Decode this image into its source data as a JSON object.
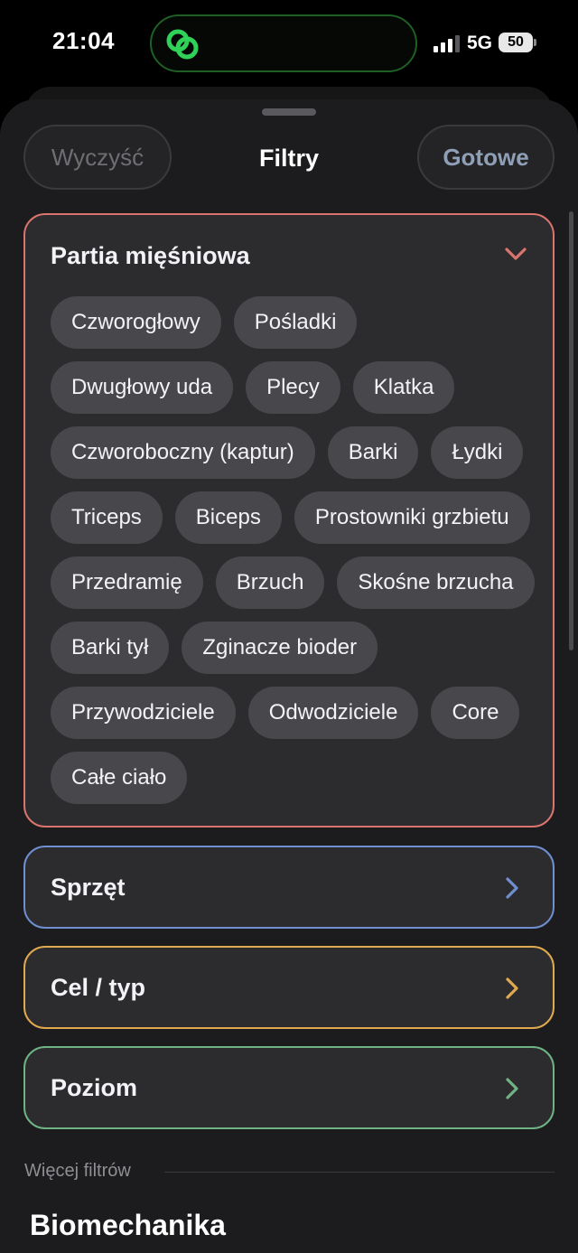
{
  "status_bar": {
    "time": "21:04",
    "network": "5G",
    "battery": "50",
    "island_icon": "link-icon",
    "island_color": "#30d158"
  },
  "header": {
    "clear_label": "Wyczyść",
    "title": "Filtry",
    "done_label": "Gotowe"
  },
  "sections": {
    "muscle": {
      "title": "Partia mięśniowa",
      "expanded": true,
      "accent": "#d9746e",
      "chips": [
        "Czworogłowy",
        "Pośladki",
        "Dwugłowy uda",
        "Plecy",
        "Klatka",
        "Czworoboczny (kaptur)",
        "Barki",
        "Łydki",
        "Triceps",
        "Biceps",
        "Prostowniki grzbietu",
        "Przedramię",
        "Brzuch",
        "Skośne brzucha",
        "Barki tył",
        "Zginacze bioder",
        "Przywodziciele",
        "Odwodziciele",
        "Core",
        "Całe ciało"
      ]
    },
    "equipment": {
      "title": "Sprzęt",
      "accent": "#6f8fd0"
    },
    "goal": {
      "title": "Cel / typ",
      "accent": "#dfa94f"
    },
    "level": {
      "title": "Poziom",
      "accent": "#6fb384"
    }
  },
  "more_filters": {
    "label": "Więcej filtrów",
    "heading": "Biomechanika"
  }
}
